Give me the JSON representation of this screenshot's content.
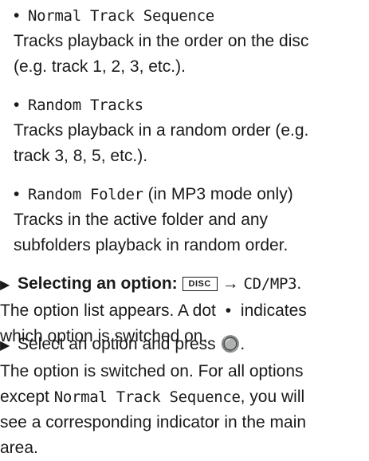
{
  "options": [
    {
      "bullet": "•",
      "name": "Normal Track Sequence",
      "desc1": "Tracks playback in the order on the disc",
      "desc2": "(e.g. track 1, 2, 3, etc.)."
    },
    {
      "bullet": "•",
      "name": "Random Tracks",
      "desc1": "Tracks playback in a random order (e.g.",
      "desc2": "track 3, 8, 5, etc.)."
    },
    {
      "bullet": "•",
      "name": "Random Folder",
      "note": " (in MP3 mode only)",
      "desc1": "Tracks in the active folder and any",
      "desc2": "subfolders playback in random order."
    }
  ],
  "step1": {
    "marker": "▶",
    "bold": "Selecting an option:",
    "key": "DISC",
    "arrow": "→",
    "target": "CD/MP3",
    "period": ".",
    "line2": "The option list appears. A dot",
    "dot": "•",
    "line2b": "indicates",
    "line3": "which option is switched on."
  },
  "step2": {
    "marker": "▶",
    "line1": "Select an option and press",
    "knob": "🔘",
    "line1end": ".",
    "line2": "The option is switched on. For all options",
    "line3a": "except",
    "mono": "Normal Track Sequence",
    "line3b": ", you will",
    "line4": "see a corresponding indicator in the main",
    "line5": "area."
  }
}
